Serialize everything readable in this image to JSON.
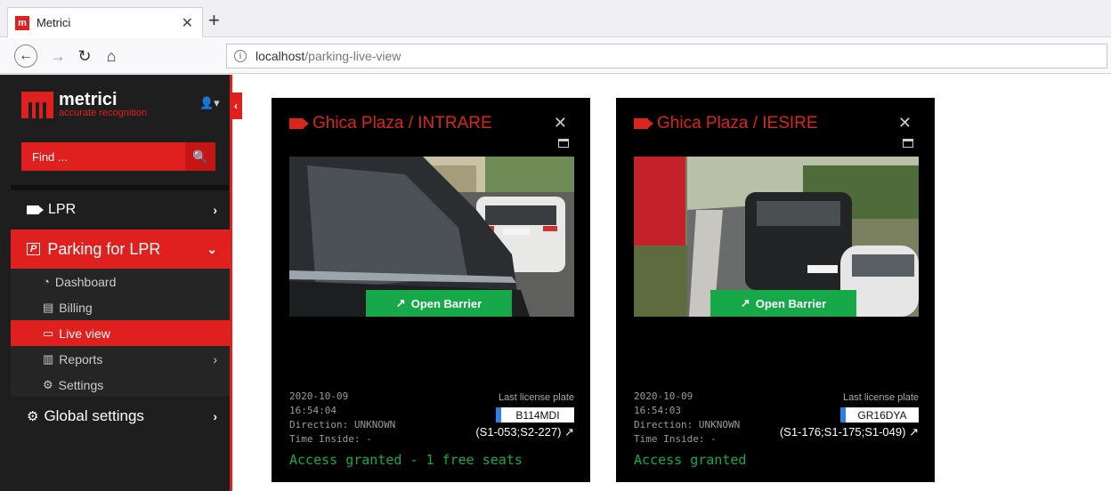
{
  "browser": {
    "tab_title": "Metrici",
    "favicon_letter": "m",
    "url_host": "localhost",
    "url_path": "/parking-live-view"
  },
  "sidebar": {
    "logo_name": "metrici",
    "logo_tagline": "accurate recognition",
    "find_placeholder": "Find ...",
    "menu": {
      "lpr": "LPR",
      "parking": "Parking for LPR",
      "parking_icon_letter": "P",
      "dashboard": "Dashboard",
      "billing": "Billing",
      "live_view": "Live view",
      "reports": "Reports",
      "settings": "Settings",
      "global_settings": "Global settings"
    }
  },
  "panels": [
    {
      "title": "Ghica Plaza / INTRARE",
      "button": "Open Barrier",
      "date": "2020-10-09",
      "time": "16:54:04",
      "direction": "Direction: UNKNOWN",
      "time_inside": "Time Inside: -",
      "last_plate_label": "Last license plate",
      "plate": "B114MDI",
      "sensors": "(S1-053;S2-227)",
      "access": "Access granted - 1 free seats"
    },
    {
      "title": "Ghica Plaza / IESIRE",
      "button": "Open Barrier",
      "date": "2020-10-09",
      "time": "16:54:03",
      "direction": "Direction: UNKNOWN",
      "time_inside": "Time Inside: -",
      "last_plate_label": "Last license plate",
      "plate": "GR16DYA",
      "sensors": "(S1-176;S1-175;S1-049)",
      "access": "Access granted"
    }
  ],
  "colors": {
    "brand_red": "#e0201e",
    "access_green": "#17a84a",
    "sidebar_bg": "#1e1e1e"
  }
}
